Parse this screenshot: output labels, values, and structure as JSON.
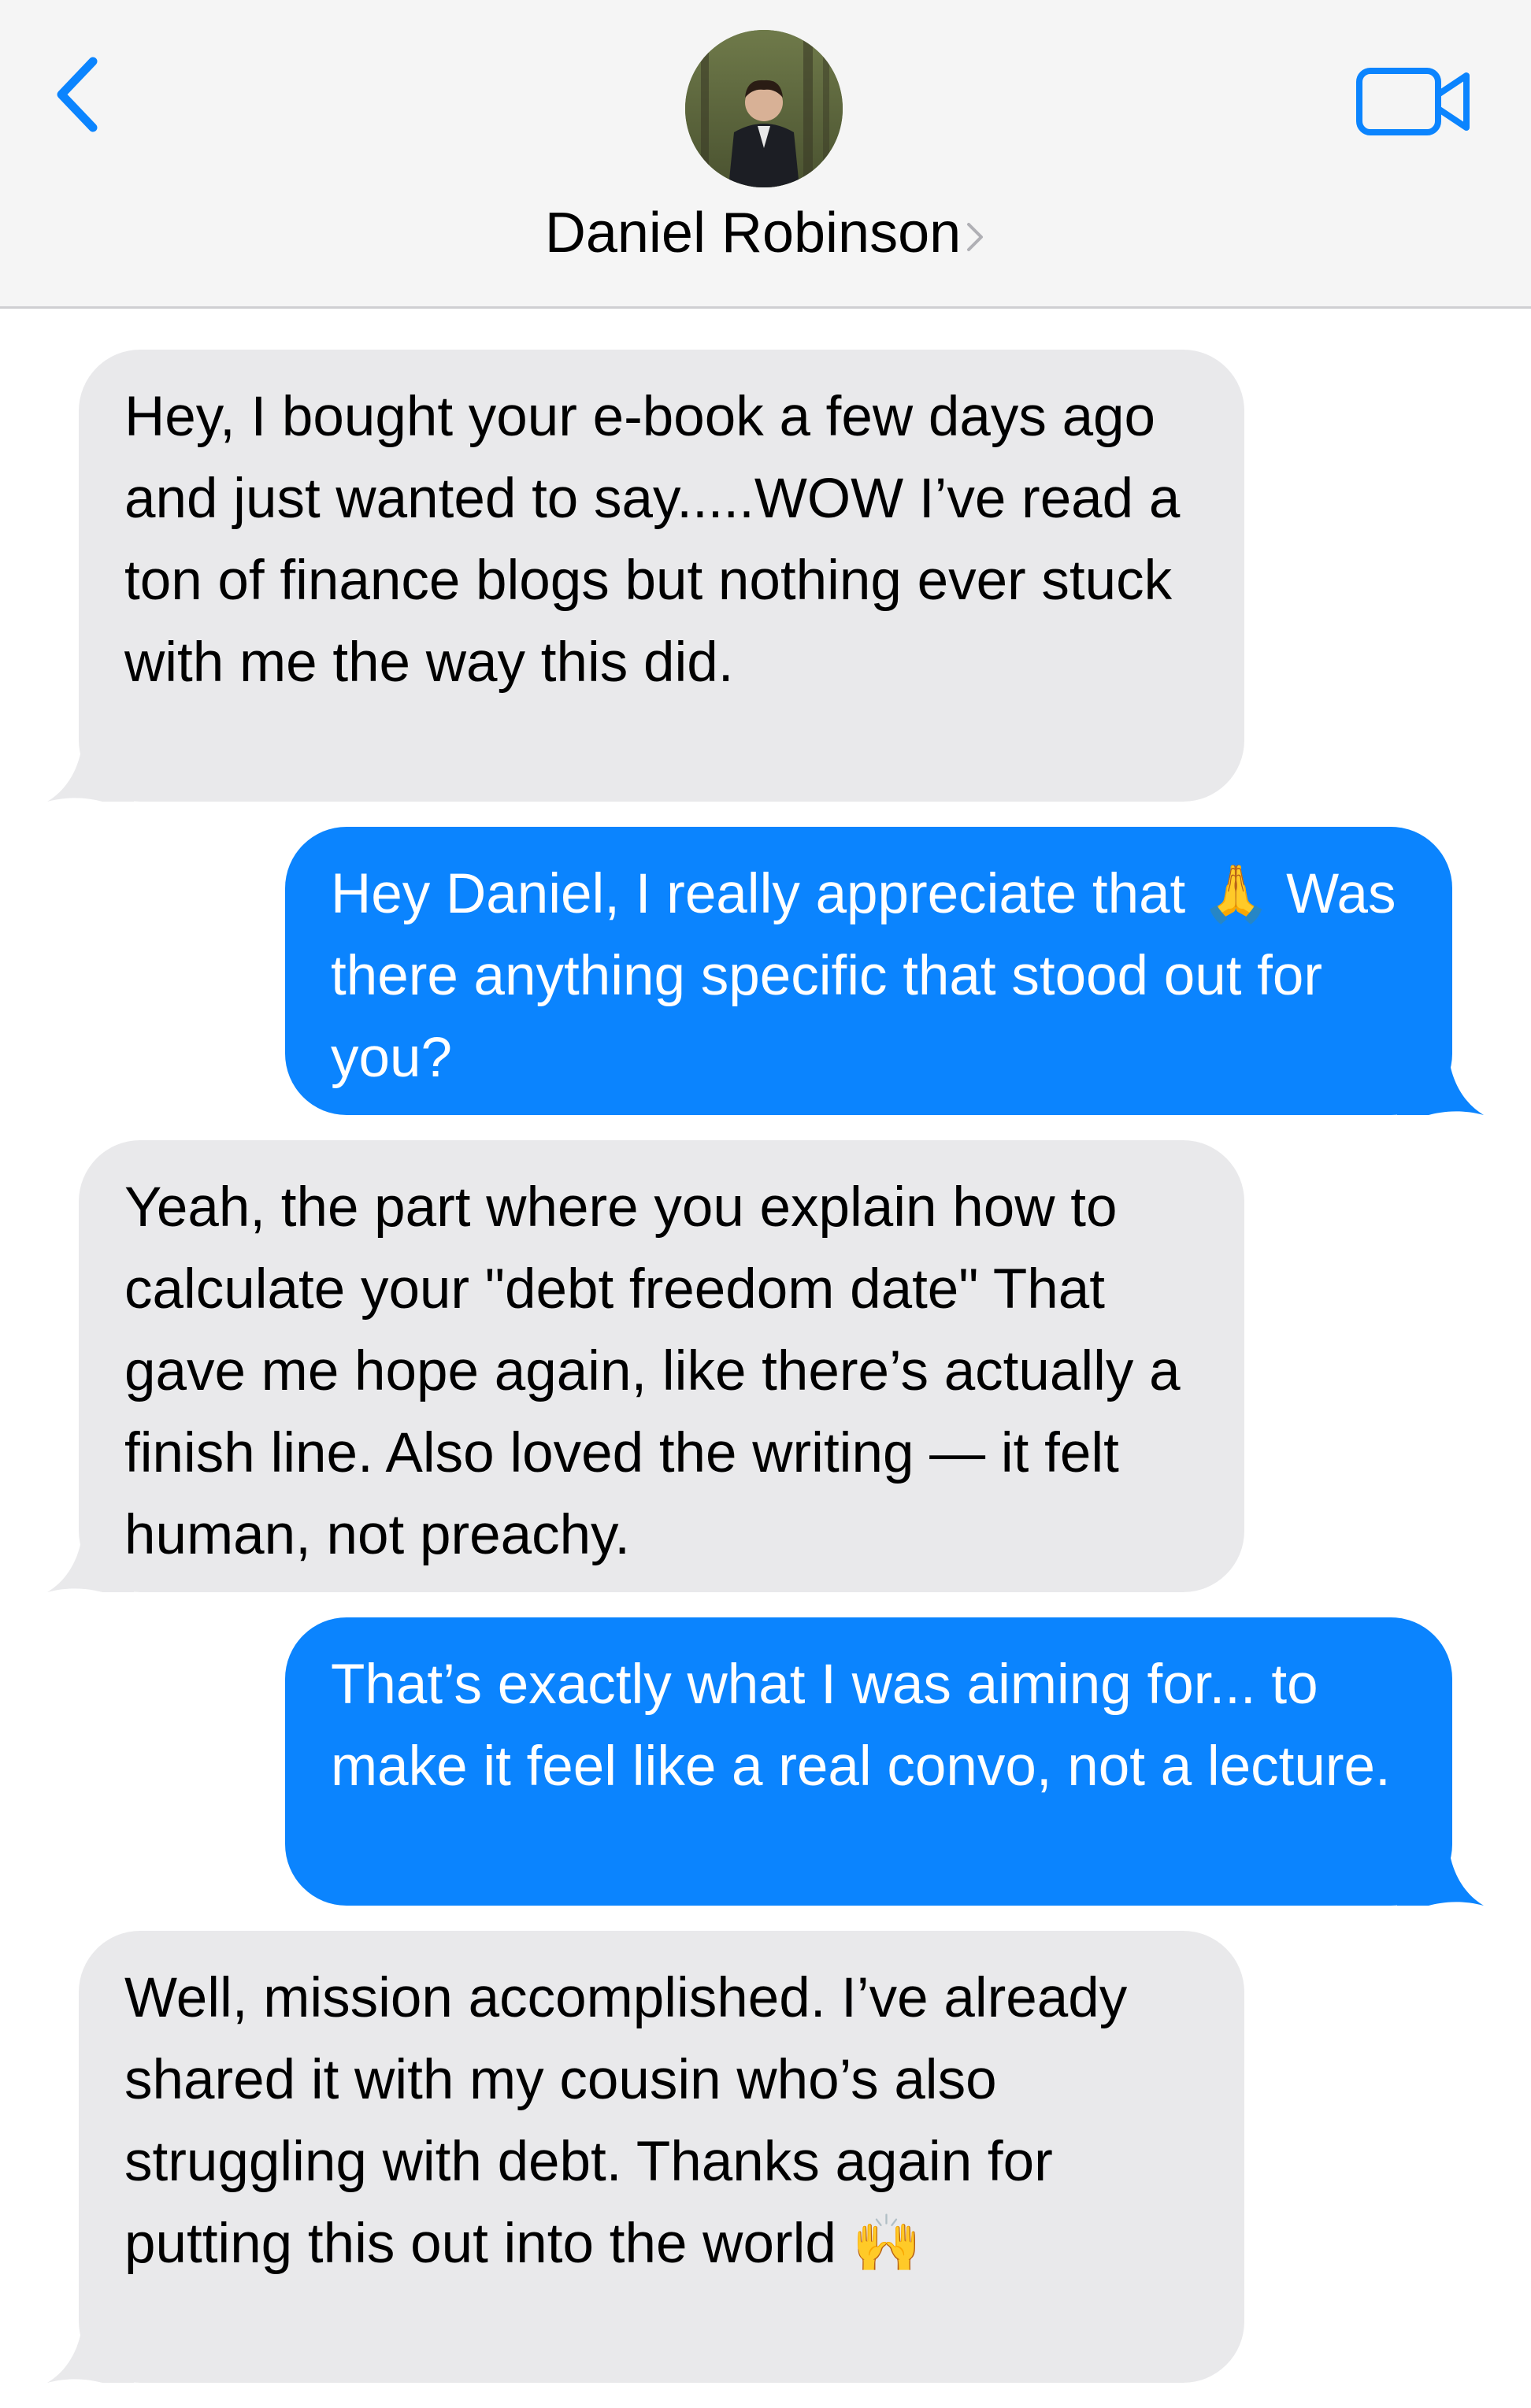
{
  "header": {
    "contact_name": "Daniel Robinson",
    "back_icon": "chevron-left-icon",
    "video_icon": "video-camera-icon",
    "disclosure_icon": "chevron-right-icon"
  },
  "colors": {
    "header_bg": "#f5f5f5",
    "accent": "#0b84fe",
    "incoming_bubble": "#e9e9eb",
    "outgoing_bubble": "#0b84fe"
  },
  "messages": [
    {
      "direction": "incoming",
      "text": "Hey, I bought your e-book a few days ago and just wanted to say.....WOW I’ve read a ton of finance blogs but nothing ever stuck with me the way this did."
    },
    {
      "direction": "outgoing",
      "text": "Hey Daniel, I really appreciate that 🙏 Was there anything specific that stood out for you?"
    },
    {
      "direction": "incoming",
      "text": "Yeah, the part where you explain how to calculate your \"debt freedom date\" That gave me hope again, like there’s actually a finish line. Also loved the writing — it felt human, not preachy."
    },
    {
      "direction": "outgoing",
      "text": "That’s exactly what I was aiming for... to make it feel like a real convo, not a lecture."
    },
    {
      "direction": "incoming",
      "text": "Well, mission accomplished. I’ve already shared it with my cousin who’s also struggling with debt. Thanks again for putting this out into the world 🙌"
    }
  ]
}
